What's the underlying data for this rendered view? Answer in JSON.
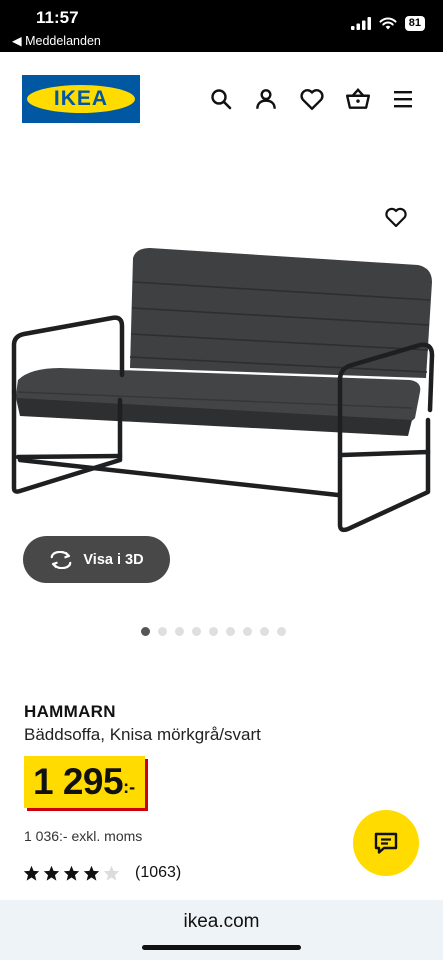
{
  "status_bar": {
    "time": "11:57",
    "back_label": "◀ Meddelanden",
    "battery": "81"
  },
  "header": {
    "logo_text": "IKEA",
    "icons": [
      "search-icon",
      "profile-icon",
      "heart-icon",
      "basket-icon",
      "menu-icon"
    ]
  },
  "product": {
    "view_3d_label": "Visa i 3D",
    "image_count": 9,
    "active_image": 1,
    "name": "HAMMARN",
    "description": "Bäddsoffa, Knisa mörkgrå/svart",
    "price_main": "1 295",
    "price_suffix": ":-",
    "price_excl_vat": "1 036:- exkl. moms",
    "rating": 4,
    "rating_max": 5,
    "review_count": "(1063)"
  },
  "browser": {
    "url": "ikea.com"
  },
  "colors": {
    "ikea_blue": "#0058a3",
    "ikea_yellow": "#ffdb00",
    "price_shadow_red": "#cc0008"
  }
}
